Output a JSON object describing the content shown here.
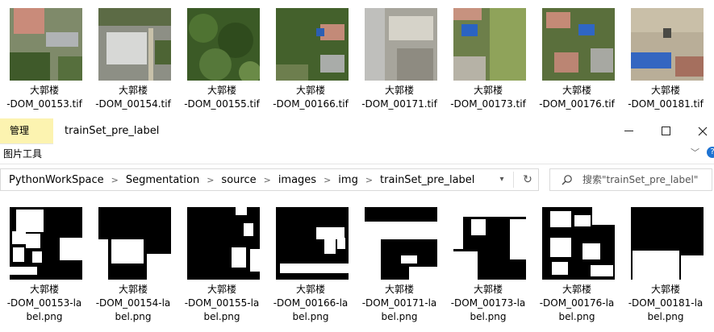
{
  "top_files": [
    {
      "line1": "大郭楼",
      "line2": "-DOM_00153.tif"
    },
    {
      "line1": "大郭楼",
      "line2": "-DOM_00154.tif"
    },
    {
      "line1": "大郭楼",
      "line2": "-DOM_00155.tif"
    },
    {
      "line1": "大郭楼",
      "line2": "-DOM_00166.tif"
    },
    {
      "line1": "大郭楼",
      "line2": "-DOM_00171.tif"
    },
    {
      "line1": "大郭楼",
      "line2": "-DOM_00173.tif"
    },
    {
      "line1": "大郭楼",
      "line2": "-DOM_00176.tif"
    },
    {
      "line1": "大郭楼",
      "line2": "-DOM_00181.tif"
    }
  ],
  "ribbon": {
    "manage_tab": "管理",
    "picture_tools_tab": "图片工具",
    "window_title": "trainSet_pre_label"
  },
  "window_controls": {
    "minimize": "—",
    "maximize": "☐",
    "close": "✕"
  },
  "address_bar": {
    "crumbs": [
      "PythonWorkSpace",
      "Segmentation",
      "source",
      "images",
      "img",
      "trainSet_pre_label"
    ]
  },
  "search": {
    "placeholder": "搜索\"trainSet_pre_label\""
  },
  "label_files": [
    {
      "line1": "大郭楼",
      "line2": "-DOM_00153-la",
      "line3": "bel.png"
    },
    {
      "line1": "大郭楼",
      "line2": "-DOM_00154-la",
      "line3": "bel.png"
    },
    {
      "line1": "大郭楼",
      "line2": "-DOM_00155-la",
      "line3": "bel.png"
    },
    {
      "line1": "大郭楼",
      "line2": "-DOM_00166-la",
      "line3": "bel.png"
    },
    {
      "line1": "大郭楼",
      "line2": "-DOM_00171-la",
      "line3": "bel.png"
    },
    {
      "line1": "大郭楼",
      "line2": "-DOM_00173-la",
      "line3": "bel.png"
    },
    {
      "line1": "大郭楼",
      "line2": "-DOM_00176-la",
      "line3": "bel.png"
    },
    {
      "line1": "大郭楼",
      "line2": "-DOM_00181-la",
      "line3": "bel.png"
    }
  ],
  "colors": {
    "manage_tab_bg": "#fcf3b0",
    "help_icon": "#1e73d2",
    "mask_bg": "#000000",
    "mask_fg": "#ffffff"
  }
}
